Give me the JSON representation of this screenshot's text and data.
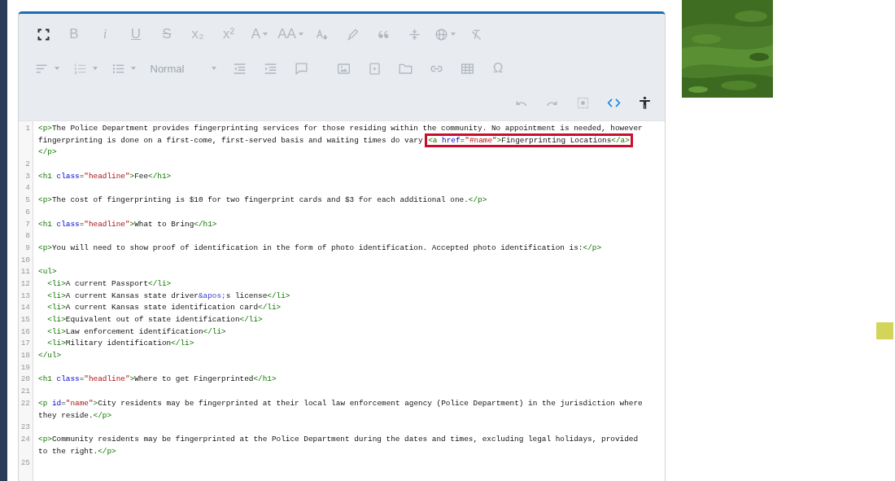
{
  "toolbar": {
    "rows": [
      {
        "groups": [
          [
            {
              "kind": "icon",
              "disabled": false,
              "active": false,
              "dropdown": false
            },
            {
              "kind": "bold",
              "glyph": "B",
              "disabled": true,
              "active": false,
              "dropdown": false
            },
            {
              "kind": "italic",
              "glyph": "i",
              "disabled": true,
              "active": false,
              "dropdown": false
            },
            {
              "kind": "underline",
              "glyph": "U",
              "disabled": true,
              "active": false,
              "dropdown": false
            },
            {
              "kind": "strike",
              "glyph": "S",
              "disabled": true,
              "active": false,
              "dropdown": false
            },
            {
              "kind": "glyph",
              "glyph": "x₂",
              "disabled": true,
              "active": false,
              "dropdown": false
            },
            {
              "kind": "glyph",
              "glyph": "x²",
              "disabled": true,
              "active": false,
              "dropdown": false
            },
            {
              "kind": "glyph",
              "glyph": "A",
              "disabled": true,
              "active": false,
              "dropdown": true
            },
            {
              "kind": "glyph",
              "glyph": "AA",
              "disabled": true,
              "active": false,
              "dropdown": true
            },
            {
              "kind": "icon",
              "disabled": true,
              "active": false,
              "dropdown": false
            },
            {
              "kind": "icon",
              "disabled": true,
              "active": false,
              "dropdown": false
            },
            {
              "kind": "icon",
              "disabled": true,
              "active": false,
              "dropdown": false
            },
            {
              "kind": "icon",
              "disabled": true,
              "active": false,
              "dropdown": false
            },
            {
              "kind": "icon",
              "disabled": true,
              "active": false,
              "dropdown": true
            },
            {
              "kind": "icon",
              "disabled": true,
              "active": false,
              "dropdown": false
            }
          ]
        ]
      },
      {
        "groups": [
          [
            {
              "kind": "icon",
              "disabled": true,
              "active": false,
              "dropdown": true
            },
            {
              "kind": "icon",
              "disabled": true,
              "active": false,
              "dropdown": true
            },
            {
              "kind": "icon",
              "disabled": true,
              "active": false,
              "dropdown": true
            },
            {
              "kind": "select",
              "label": "Normal",
              "disabled": true,
              "active": false,
              "dropdown": true
            },
            {
              "kind": "icon",
              "disabled": true,
              "active": false,
              "dropdown": false
            },
            {
              "kind": "icon",
              "disabled": true,
              "active": false,
              "dropdown": false
            },
            {
              "kind": "icon",
              "disabled": true,
              "active": false,
              "dropdown": false
            }
          ],
          [
            {
              "kind": "icon",
              "disabled": true,
              "active": false,
              "dropdown": false
            },
            {
              "kind": "icon",
              "disabled": true,
              "active": false,
              "dropdown": false
            },
            {
              "kind": "icon",
              "disabled": true,
              "active": false,
              "dropdown": false
            },
            {
              "kind": "icon",
              "disabled": true,
              "active": false,
              "dropdown": false
            },
            {
              "kind": "icon",
              "disabled": true,
              "active": false,
              "dropdown": false
            },
            {
              "kind": "glyph",
              "glyph": "Ω",
              "disabled": true,
              "active": false,
              "dropdown": false
            }
          ]
        ]
      },
      {
        "groups": [
          [
            {
              "kind": "icon",
              "disabled": true,
              "active": false,
              "dropdown": false
            },
            {
              "kind": "icon",
              "disabled": true,
              "active": false,
              "dropdown": false
            },
            {
              "kind": "icon",
              "disabled": true,
              "active": false,
              "dropdown": false
            },
            {
              "kind": "icon",
              "disabled": false,
              "active": true,
              "dropdown": false
            },
            {
              "kind": "icon",
              "disabled": false,
              "active": false,
              "dropdown": false
            }
          ]
        ]
      }
    ]
  },
  "code": {
    "lines": [
      {
        "number": "1",
        "rows": [
          {
            "tokens": [
              {
                "kind": "tag",
                "text": "<p>"
              },
              {
                "kind": "text",
                "text": "The Police Department provides fingerprinting services for those residing within the community. No appointment is needed, however"
              }
            ]
          },
          {
            "tokens": [
              {
                "kind": "text",
                "text": "fingerprinting is done on a first-come, first-served basis and waiting times do vary "
              }
            ],
            "callout": [
              {
                "kind": "tag",
                "text": "<a "
              },
              {
                "kind": "attr",
                "text": "href"
              },
              {
                "kind": "text",
                "text": "="
              },
              {
                "kind": "str",
                "text": "\"#name\""
              },
              {
                "kind": "tag",
                "text": ">"
              },
              {
                "kind": "text",
                "text": "Fingerprinting Locations"
              },
              {
                "kind": "tag",
                "text": "</a>"
              }
            ]
          },
          {
            "tokens": [
              {
                "kind": "tag",
                "text": "</p>"
              }
            ]
          }
        ]
      },
      {
        "number": "2"
      },
      {
        "number": "3",
        "rows": [
          {
            "tokens": [
              {
                "kind": "tag",
                "text": "<h1 "
              },
              {
                "kind": "attr",
                "text": "class"
              },
              {
                "kind": "text",
                "text": "="
              },
              {
                "kind": "str",
                "text": "\"headline\""
              },
              {
                "kind": "tag",
                "text": ">"
              },
              {
                "kind": "text",
                "text": "Fee"
              },
              {
                "kind": "tag",
                "text": "</h1>"
              }
            ]
          }
        ]
      },
      {
        "number": "4"
      },
      {
        "number": "5",
        "rows": [
          {
            "tokens": [
              {
                "kind": "tag",
                "text": "<p>"
              },
              {
                "kind": "text",
                "text": "The cost of fingerprinting is $10 for two fingerprint cards and $3 for each additional one."
              },
              {
                "kind": "tag",
                "text": "</p>"
              }
            ]
          }
        ]
      },
      {
        "number": "6"
      },
      {
        "number": "7",
        "rows": [
          {
            "tokens": [
              {
                "kind": "tag",
                "text": "<h1 "
              },
              {
                "kind": "attr",
                "text": "class"
              },
              {
                "kind": "text",
                "text": "="
              },
              {
                "kind": "str",
                "text": "\"headline\""
              },
              {
                "kind": "tag",
                "text": ">"
              },
              {
                "kind": "text",
                "text": "What to Bring"
              },
              {
                "kind": "tag",
                "text": "</h1>"
              }
            ]
          }
        ]
      },
      {
        "number": "8"
      },
      {
        "number": "9",
        "rows": [
          {
            "tokens": [
              {
                "kind": "tag",
                "text": "<p>"
              },
              {
                "kind": "text",
                "text": "You will need to show proof of identification in the form of photo identification. Accepted photo identification is:"
              },
              {
                "kind": "tag",
                "text": "</p>"
              }
            ]
          }
        ]
      },
      {
        "number": "10"
      },
      {
        "number": "11",
        "rows": [
          {
            "tokens": [
              {
                "kind": "tag",
                "text": "<ul>"
              }
            ]
          }
        ]
      },
      {
        "number": "12",
        "rows": [
          {
            "tokens": [
              {
                "kind": "tag",
                "text": "  <li>"
              },
              {
                "kind": "text",
                "text": "A current Passport"
              },
              {
                "kind": "tag",
                "text": "</li>"
              }
            ]
          }
        ]
      },
      {
        "number": "13",
        "rows": [
          {
            "tokens": [
              {
                "kind": "tag",
                "text": "  <li>"
              },
              {
                "kind": "text",
                "text": "A current Kansas state driver"
              },
              {
                "kind": "ent",
                "text": "&apos;"
              },
              {
                "kind": "text",
                "text": "s license"
              },
              {
                "kind": "tag",
                "text": "</li>"
              }
            ]
          }
        ]
      },
      {
        "number": "14",
        "rows": [
          {
            "tokens": [
              {
                "kind": "tag",
                "text": "  <li>"
              },
              {
                "kind": "text",
                "text": "A current Kansas state identification card"
              },
              {
                "kind": "tag",
                "text": "</li>"
              }
            ]
          }
        ]
      },
      {
        "number": "15",
        "rows": [
          {
            "tokens": [
              {
                "kind": "tag",
                "text": "  <li>"
              },
              {
                "kind": "text",
                "text": "Equivalent out of state identification"
              },
              {
                "kind": "tag",
                "text": "</li>"
              }
            ]
          }
        ]
      },
      {
        "number": "16",
        "rows": [
          {
            "tokens": [
              {
                "kind": "tag",
                "text": "  <li>"
              },
              {
                "kind": "text",
                "text": "Law enforcement identification"
              },
              {
                "kind": "tag",
                "text": "</li>"
              }
            ]
          }
        ]
      },
      {
        "number": "17",
        "rows": [
          {
            "tokens": [
              {
                "kind": "tag",
                "text": "  <li>"
              },
              {
                "kind": "text",
                "text": "Military identification"
              },
              {
                "kind": "tag",
                "text": "</li>"
              }
            ]
          }
        ]
      },
      {
        "number": "18",
        "rows": [
          {
            "tokens": [
              {
                "kind": "tag",
                "text": "</ul>"
              }
            ]
          }
        ]
      },
      {
        "number": "19"
      },
      {
        "number": "20",
        "rows": [
          {
            "tokens": [
              {
                "kind": "tag",
                "text": "<h1 "
              },
              {
                "kind": "attr",
                "text": "class"
              },
              {
                "kind": "text",
                "text": "="
              },
              {
                "kind": "str",
                "text": "\"headline\""
              },
              {
                "kind": "tag",
                "text": ">"
              },
              {
                "kind": "text",
                "text": "Where to get Fingerprinted"
              },
              {
                "kind": "tag",
                "text": "</h1>"
              }
            ]
          }
        ]
      },
      {
        "number": "21"
      },
      {
        "number": "22",
        "rows": [
          {
            "tokens": [
              {
                "kind": "tag",
                "text": "<p "
              },
              {
                "kind": "attr",
                "text": "id"
              },
              {
                "kind": "text",
                "text": "="
              },
              {
                "kind": "str",
                "text": "\"name\""
              },
              {
                "kind": "tag",
                "text": ">"
              },
              {
                "kind": "text",
                "text": "City residents may be fingerprinted at their local law enforcement agency (Police Department) in the jurisdiction where"
              }
            ]
          },
          {
            "tokens": [
              {
                "kind": "text",
                "text": "they reside."
              },
              {
                "kind": "tag",
                "text": "</p>"
              }
            ]
          }
        ]
      },
      {
        "number": "23"
      },
      {
        "number": "24",
        "rows": [
          {
            "tokens": [
              {
                "kind": "tag",
                "text": "<p>"
              },
              {
                "kind": "text",
                "text": "Community residents may be fingerprinted at the Police Department during the dates and times, excluding legal holidays, provided"
              }
            ]
          },
          {
            "tokens": [
              {
                "kind": "text",
                "text": "to the right."
              },
              {
                "kind": "tag",
                "text": "</p>"
              }
            ]
          }
        ]
      },
      {
        "number": "25"
      }
    ]
  }
}
